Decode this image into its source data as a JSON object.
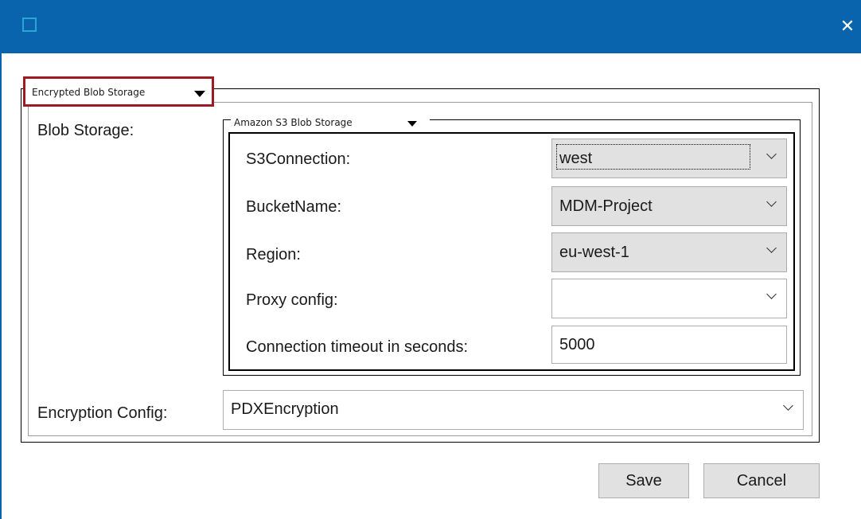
{
  "window": {
    "close_icon": "close-icon",
    "app_icon": "window-icon"
  },
  "outer": {
    "legend": "Encrypted Blob Storage",
    "blob_storage_label": "Blob Storage:"
  },
  "inner": {
    "legend": "Amazon S3 Blob Storage"
  },
  "fields": {
    "s3connection": {
      "label": "S3Connection:",
      "value": "west"
    },
    "bucketname": {
      "label": "BucketName:",
      "value": "MDM-Project"
    },
    "region": {
      "label": "Region:",
      "value": "eu-west-1"
    },
    "proxy": {
      "label": "Proxy config:",
      "value": ""
    },
    "timeout": {
      "label": "Connection timeout in seconds:",
      "value": "5000"
    }
  },
  "encryption": {
    "label": "Encryption Config:",
    "value": "PDXEncryption"
  },
  "buttons": {
    "save": "Save",
    "cancel": "Cancel"
  },
  "colors": {
    "titlebar": "#0a64ad",
    "legend_highlight": "#9b1c22"
  }
}
